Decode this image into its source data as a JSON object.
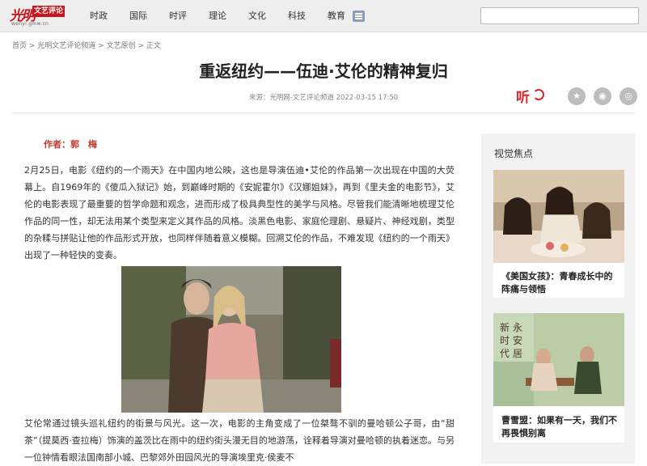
{
  "header": {
    "logo_calligraphy": "光明",
    "logo_tag": "文艺评论",
    "logo_url": "wenyi.gmw.cn",
    "nav": [
      "时政",
      "国际",
      "时评",
      "理论",
      "文化",
      "科技",
      "教育"
    ],
    "menu_icon": "menu-list-icon",
    "search_value": ""
  },
  "breadcrumb": [
    "首页",
    "光明文艺评论频道",
    "文艺原创",
    "正文"
  ],
  "breadcrumb_sep": " > ",
  "article": {
    "title": "重返纽约——伍迪·艾伦的精神复归",
    "meta": "来源：光明网-文艺评论频道  2022-03-15 17:50",
    "listen_label": "听",
    "share_icons": [
      "star-icon",
      "wechat-icon",
      "weibo-icon"
    ],
    "author": "作者：郭　梅",
    "paragraphs": [
      "2月25日，电影《纽约的一个雨天》在中国内地公映，这也是导演伍迪•艾伦的作品第一次出现在中国的大荧幕上。自1969年的《傻瓜入狱记》始，到巅峰时期的《安妮霍尔》《汉娜姐妹》，再到《里夫金的电影节》，艾伦的电影表现了最重要的哲学命题和观念，进而形成了极具典型性的美学与风格。尽管我们能清晰地梳理艾伦作品的同一性，却无法用某个类型来定义其作品的风格。淡黑色电影、家庭伦理剧、悬疑片、神经戏剧，类型的杂糅与拼贴让他的作品形式开放，也同样伴随着意义模糊。回溯艾伦的作品，不难发现《纽约的一个雨天》出现了一种轻快的变奏。",
      "艾伦常通过镜头巡礼纽约的街景与风光。这一次，电影的主角变成了一位桀骜不驯的曼哈顿公子哥，由“甜茶”（提莫西·查拉梅）饰演的盖茨比在雨中的纽约街头漫无目的地游荡，诠释着导演对曼哈顿的执着迷恋。与另一位钟情看眼法国南部小城、巴黎郊外田园风光的导演埃里克·侯麦不"
    ]
  },
  "sidebar": {
    "heading": "视觉焦点",
    "cards": [
      {
        "caption": "《美国女孩》：青春成长中的阵痛与领悟"
      },
      {
        "caption": "曹雪盟：如果有一天，我们不再畏惧别离"
      }
    ]
  }
}
